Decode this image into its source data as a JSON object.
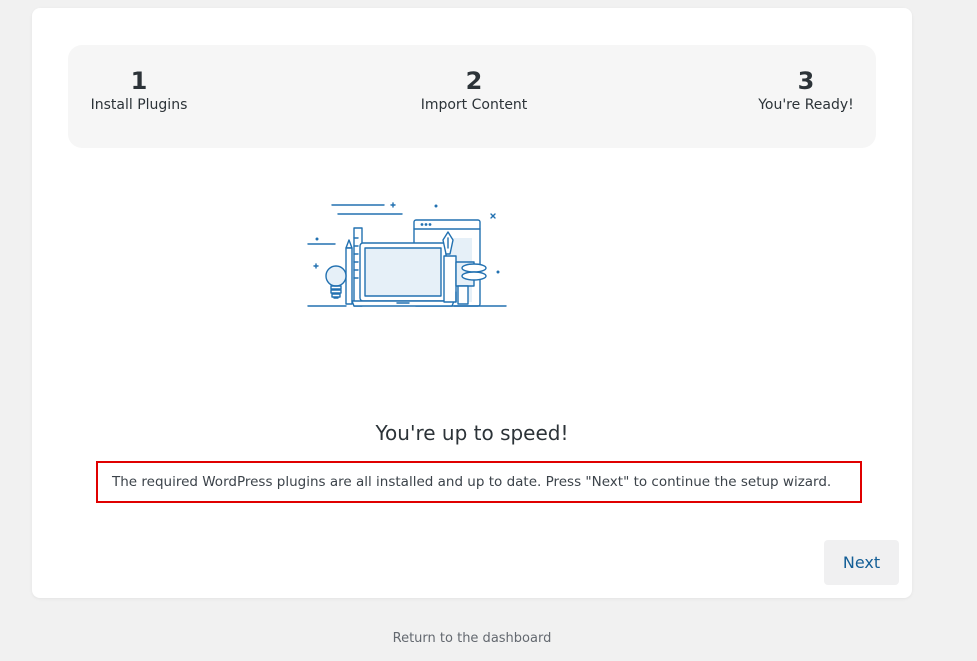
{
  "steps": [
    {
      "number": "1",
      "label": "Install Plugins"
    },
    {
      "number": "2",
      "label": "Import Content"
    },
    {
      "number": "3",
      "label": "You're Ready!"
    }
  ],
  "illustration": {
    "icon": "workspace-illustration-icon",
    "accent": "#2271b1",
    "fill": "#e6f0f8"
  },
  "content": {
    "heading": "You're up to speed!",
    "message": "The required WordPress plugins are all installed and up to date. Press \"Next\" to continue the setup wizard."
  },
  "actions": {
    "next_label": "Next"
  },
  "footer": {
    "return_label": "Return to the dashboard"
  },
  "colors": {
    "highlight_border": "#e00000",
    "link": "#135e96"
  }
}
